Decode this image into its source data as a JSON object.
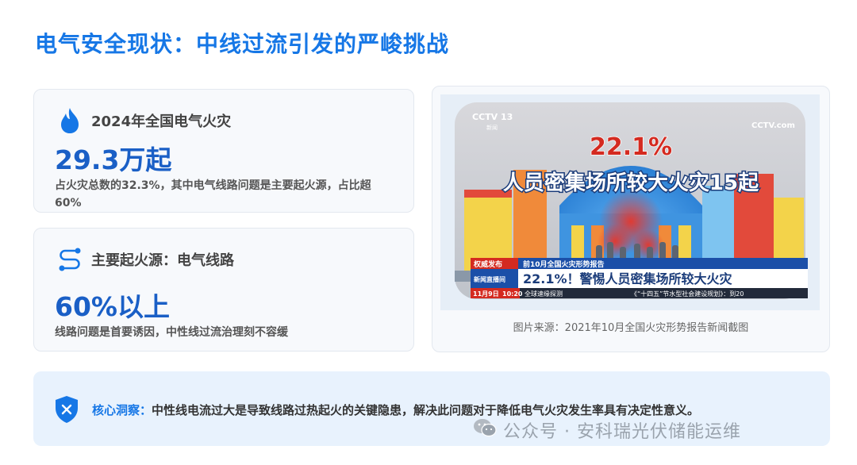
{
  "title": "电气安全现状：中线过流引发的严峻挑战",
  "card1": {
    "icon": "flame-icon",
    "label": "2024年全国电气火灾",
    "value": "29.3万起",
    "desc": "占火灾总数的32.3%，其中电气线路问题是主要起火源，占比超60%"
  },
  "card2": {
    "icon": "route-icon",
    "label": "主要起火源：电气线路",
    "value": "60%以上",
    "desc": "线路问题是首要诱因，中性线过流治理刻不容缓"
  },
  "image": {
    "logo_left": "CCTV 13",
    "logo_left_sub": "新闻",
    "logo_right": "CCTV.com",
    "headline_pct": "22.1%",
    "headline": "人员密集场所较大火灾15起",
    "ticker_tag1": "权威发布",
    "ticker_tag2": "新闻直播间",
    "ticker_title": "前10月全国火灾形势报告",
    "ticker_main": "22.1%！警惕人员密集场所较大火灾",
    "ticker_date": "11月9日",
    "ticker_time": "10:20",
    "ticker_scroll1": "全球速缘探测",
    "ticker_scroll2": "《“十四五”节水型社会建设规划》：到20",
    "caption": "图片来源：2021年10月全国火灾形势报告新闻截图"
  },
  "banner": {
    "icon": "shield-x-icon",
    "key": "核心洞察：",
    "text": "中性线电流过大是导致线路过热起火的关键隐患，解决此问题对于降低电气火灾发生率具有决定性意义。"
  },
  "watermark": {
    "icon": "wechat-icon",
    "text": "公众号 · 安科瑞光伏储能运维"
  },
  "colors": {
    "accent": "#1677e6",
    "value": "#1a5fc6"
  }
}
